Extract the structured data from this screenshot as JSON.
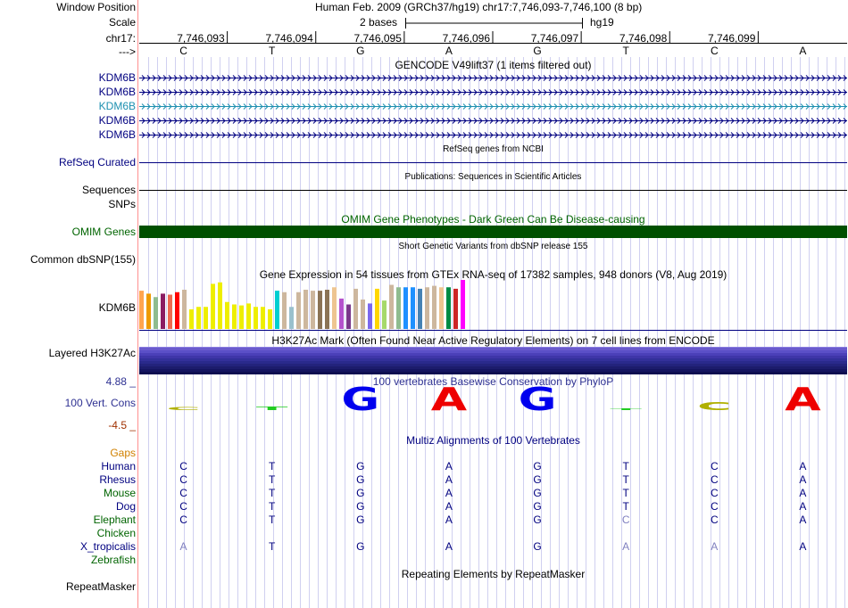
{
  "colors": {
    "grid": "#d0d0f0",
    "label_blue": "#000080",
    "omim_green": "#005000",
    "refseq_navy": "#000080",
    "phylop_pos": "#2e3192",
    "gap_orange": "#d08000",
    "highlight_kdm6b": "#1e90b0"
  },
  "ruler": {
    "window_position_label": "Window Position",
    "window_position_value": "Human Feb. 2009 (GRCh37/hg19)   chr17:7,746,093-7,746,100 (8 bp)",
    "scale_label": "Scale",
    "scale_value": "2 bases",
    "assembly": "hg19",
    "chrom_label": "chr17:",
    "arrow_label": "--->",
    "positions": [
      "7,746,093",
      "7,746,094",
      "7,746,095",
      "7,746,096",
      "7,746,097",
      "7,746,098",
      "7,746,099"
    ],
    "bases": [
      "C",
      "T",
      "G",
      "A",
      "G",
      "T",
      "C",
      "A"
    ]
  },
  "gencode": {
    "title": "GENCODE V49lift37 (1 items filtered out)",
    "genes": [
      "KDM6B",
      "KDM6B",
      "KDM6B",
      "KDM6B",
      "KDM6B"
    ]
  },
  "refseq": {
    "title": "RefSeq genes from NCBI",
    "label": "RefSeq Curated"
  },
  "publications": {
    "title": "Publications: Sequences in Scientific Articles",
    "label": "Sequences"
  },
  "snps_label": "SNPs",
  "omim": {
    "title": "OMIM Gene Phenotypes - Dark Green Can Be Disease-causing",
    "label": "OMIM Genes"
  },
  "dbsnp": {
    "title": "Short Genetic Variants from dbSNP release 155",
    "label": "Common dbSNP(155)"
  },
  "gtex": {
    "title": "Gene Expression in 54 tissues from GTEx RNA-seq of 17382 samples, 948 donors (V8, Aug 2019)",
    "label": "KDM6B",
    "bars": [
      {
        "v": 0.78,
        "c": "#ffa54f"
      },
      {
        "v": 0.72,
        "c": "#ee9a00"
      },
      {
        "v": 0.65,
        "c": "#8fbc8f"
      },
      {
        "v": 0.72,
        "c": "#8b1c62"
      },
      {
        "v": 0.7,
        "c": "#ee6a50"
      },
      {
        "v": 0.75,
        "c": "#ff0000"
      },
      {
        "v": 0.8,
        "c": "#cdb79e"
      },
      {
        "v": 0.4,
        "c": "#eeee00"
      },
      {
        "v": 0.45,
        "c": "#eeee00"
      },
      {
        "v": 0.45,
        "c": "#eeee00"
      },
      {
        "v": 0.92,
        "c": "#eeee00"
      },
      {
        "v": 0.95,
        "c": "#eeee00"
      },
      {
        "v": 0.55,
        "c": "#eeee00"
      },
      {
        "v": 0.5,
        "c": "#eeee00"
      },
      {
        "v": 0.48,
        "c": "#eeee00"
      },
      {
        "v": 0.52,
        "c": "#eeee00"
      },
      {
        "v": 0.45,
        "c": "#eeee00"
      },
      {
        "v": 0.45,
        "c": "#eeee00"
      },
      {
        "v": 0.4,
        "c": "#eeee00"
      },
      {
        "v": 0.78,
        "c": "#00ced1"
      },
      {
        "v": 0.75,
        "c": "#cdb79e"
      },
      {
        "v": 0.45,
        "c": "#9ac0cd"
      },
      {
        "v": 0.75,
        "c": "#cdb79e"
      },
      {
        "v": 0.8,
        "c": "#cdb79e"
      },
      {
        "v": 0.78,
        "c": "#cdb79e"
      },
      {
        "v": 0.78,
        "c": "#8b7355"
      },
      {
        "v": 0.8,
        "c": "#8b7355"
      },
      {
        "v": 0.85,
        "c": "#eec591"
      },
      {
        "v": 0.62,
        "c": "#b452cd"
      },
      {
        "v": 0.5,
        "c": "#7a378b"
      },
      {
        "v": 0.82,
        "c": "#cdb79e"
      },
      {
        "v": 0.6,
        "c": "#cdb79e"
      },
      {
        "v": 0.52,
        "c": "#7b68ee"
      },
      {
        "v": 0.82,
        "c": "#ffd700"
      },
      {
        "v": 0.58,
        "c": "#a6d96a"
      },
      {
        "v": 0.9,
        "c": "#cdb79e"
      },
      {
        "v": 0.85,
        "c": "#8fbc8f"
      },
      {
        "v": 0.85,
        "c": "#1e90ff"
      },
      {
        "v": 0.85,
        "c": "#1e90ff"
      },
      {
        "v": 0.82,
        "c": "#4682b4"
      },
      {
        "v": 0.85,
        "c": "#cdb79e"
      },
      {
        "v": 0.88,
        "c": "#cdb79e"
      },
      {
        "v": 0.85,
        "c": "#eec591"
      },
      {
        "v": 0.85,
        "c": "#008b45"
      },
      {
        "v": 0.82,
        "c": "#cd2626"
      },
      {
        "v": 1.0,
        "c": "#ff00ff"
      }
    ]
  },
  "h3k27ac": {
    "title": "H3K27Ac Mark (Often Found Near Active Regulatory Elements) on 7 cell lines from ENCODE",
    "label": "Layered H3K27Ac"
  },
  "conservation": {
    "title": "100 vertebrates Basewise Conservation by PhyloP",
    "label": "100 Vert. Cons",
    "ymax": "4.88 _",
    "ymin": "-4.5 _",
    "letters": [
      {
        "b": "C",
        "h": 0.12,
        "c": "#b0b000"
      },
      {
        "b": "T",
        "h": 0.15,
        "c": "#22cc22"
      },
      {
        "b": "G",
        "h": 1.0,
        "c": "#0000ee"
      },
      {
        "b": "A",
        "h": 1.0,
        "c": "#ee0000"
      },
      {
        "b": "G",
        "h": 1.0,
        "c": "#0000ee"
      },
      {
        "b": "T",
        "h": 0.08,
        "c": "#22cc22"
      },
      {
        "b": "C",
        "h": 0.35,
        "c": "#b0b000"
      },
      {
        "b": "A",
        "h": 1.0,
        "c": "#ee0000"
      }
    ]
  },
  "multiz": {
    "title": "Multiz Alignments of 100 Vertebrates",
    "gaps_label": "Gaps",
    "species": [
      {
        "name": "Human",
        "color": "#000080",
        "bases": [
          "C",
          "T",
          "G",
          "A",
          "G",
          "T",
          "C",
          "A"
        ],
        "dim": []
      },
      {
        "name": "Rhesus",
        "color": "#000080",
        "bases": [
          "C",
          "T",
          "G",
          "A",
          "G",
          "T",
          "C",
          "A"
        ],
        "dim": []
      },
      {
        "name": "Mouse",
        "color": "#006400",
        "bases": [
          "C",
          "T",
          "G",
          "A",
          "G",
          "T",
          "C",
          "A"
        ],
        "dim": []
      },
      {
        "name": "Dog",
        "color": "#000080",
        "bases": [
          "C",
          "T",
          "G",
          "A",
          "G",
          "T",
          "C",
          "A"
        ],
        "dim": []
      },
      {
        "name": "Elephant",
        "color": "#006400",
        "bases": [
          "C",
          "T",
          "G",
          "A",
          "G",
          "C",
          "C",
          "A"
        ],
        "dim": [
          5
        ]
      },
      {
        "name": "Chicken",
        "color": "#006400",
        "bases": [
          "",
          "",
          "",
          "",
          "",
          "",
          "",
          ""
        ],
        "dim": []
      },
      {
        "name": "X_tropicalis",
        "color": "#000080",
        "bases": [
          "A",
          "T",
          "G",
          "A",
          "G",
          "A",
          "A",
          "A"
        ],
        "dim": [
          0,
          5,
          6
        ]
      },
      {
        "name": "Zebrafish",
        "color": "#006400",
        "bases": [
          "",
          "",
          "",
          "",
          "",
          "",
          "",
          ""
        ],
        "dim": []
      }
    ]
  },
  "repeatmasker": {
    "title": "Repeating Elements by RepeatMasker",
    "label": "RepeatMasker"
  }
}
